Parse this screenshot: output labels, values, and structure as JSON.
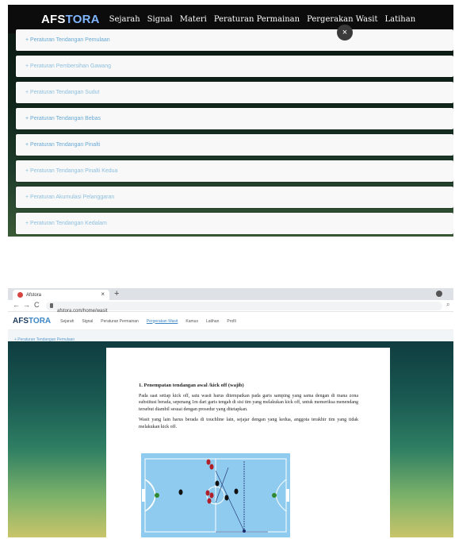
{
  "top": {
    "brand_prefix": "AFS",
    "brand_suffix": "TORA",
    "nav": [
      "Sejarah",
      "Signal",
      "Materi",
      "Peraturan Permainan",
      "Pergerakan Wasit",
      "Latihan"
    ],
    "close_label": "×",
    "accordion": [
      "+ Peraturan Tendangan Pemulaan",
      "+ Peraturan Pembersihan Gawang",
      "+ Peraturan Tendangan Sudut",
      "+ Peraturan Tendangan Bebas",
      "+ Peraturan Tendangan Pinalti",
      "+ Peraturan Tendangan Pinalti Kedua",
      "+ Peraturan Akumulasi Pelanggaran",
      "+ Peraturan Tendangan Kedalam"
    ]
  },
  "bottom": {
    "tab_title": "Afstora",
    "tab_close": "×",
    "new_tab": "+",
    "nav_back": "←",
    "nav_forward": "→",
    "nav_reload": "C",
    "url": "afstora.com/home/wasit",
    "search_icon": "⌕",
    "brand_prefix": "AFS",
    "brand_suffix": "TORA",
    "nav": [
      "Sejarah",
      "Signal",
      "Peraturan Permainan",
      "Pergerakan Wasit",
      "Kamus",
      "Latihan",
      "Profil"
    ],
    "active_nav_index": 3,
    "breadcrumb": "+ Peraturan Tendangan Pemulaan",
    "doc": {
      "heading": "1. Penempatan tendangan awal /kick off (wajib)",
      "para1": "Pada saat setiap kick off, satu wasit harus ditempatkan pada garis samping yang sama dengan di mana zona substitusi berada, sepenang 1m dari garis tengah di sisi tim yang melakukan kick off, untuk memeriksa menendang tersebut diambil sesuai dengan prosedur yang ditetapkan.",
      "para2": "Wasit yang lain harus berada di touchline lain, sejajar dengan yang kedua, anggota terakhir tim yang tidak melakukan kick off."
    }
  },
  "colors": {
    "accent_blue": "#3d86c6",
    "court": "#8ecbef",
    "top_link": "#6aa9d6"
  }
}
